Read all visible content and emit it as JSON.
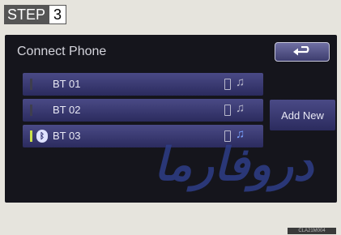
{
  "step": {
    "label": "STEP",
    "number": "3"
  },
  "screen": {
    "title": "Connect Phone",
    "back_icon": "back-arrow-icon",
    "add_new_label": "Add New",
    "devices": [
      {
        "name": "BT 01",
        "connected": false
      },
      {
        "name": "BT 02",
        "connected": false
      },
      {
        "name": "BT 03",
        "connected": true
      }
    ]
  },
  "watermark": "دروفارما",
  "image_code": "CLA21M004",
  "colors": {
    "accent_connected": "#c9e04a",
    "audio_active": "#7aa2ff",
    "button_top": "#4a4a86",
    "button_bottom": "#2b2b5e"
  }
}
